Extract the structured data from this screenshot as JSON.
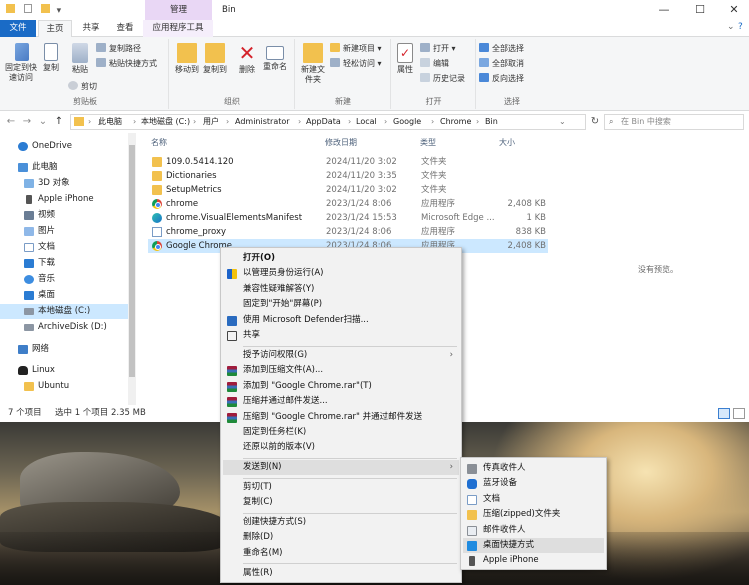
{
  "window": {
    "title": "Bin",
    "manage_tab": "管理",
    "controls": {
      "minimize": "—",
      "maximize": "☐",
      "close": "✕"
    }
  },
  "ribbon_tabs": [
    "文件",
    "主页",
    "共享",
    "查看",
    "应用程序工具"
  ],
  "ribbon": {
    "clipboard": {
      "label": "剪贴板",
      "pin": "固定到快速访问",
      "copy": "复制",
      "paste": "粘贴",
      "copy_path": "复制路径",
      "paste_shortcut": "粘贴快捷方式",
      "cut": "剪切"
    },
    "organize": {
      "label": "组织",
      "move_to": "移动到",
      "copy_to": "复制到",
      "delete": "删除",
      "rename": "重命名"
    },
    "new": {
      "label": "新建",
      "new_folder": "新建文件夹",
      "new_item": "新建项目 ▾",
      "easy_access": "轻松访问 ▾"
    },
    "open": {
      "label": "打开",
      "properties": "属性",
      "open": "打开 ▾",
      "edit": "编辑",
      "history": "历史记录"
    },
    "select": {
      "label": "选择",
      "select_all": "全部选择",
      "select_none": "全部取消",
      "invert": "反向选择"
    }
  },
  "address": {
    "crumbs": [
      "此电脑",
      "本地磁盘 (C:)",
      "用户",
      "Administrator",
      "AppData",
      "Local",
      "Google",
      "Chrome",
      "Bin"
    ],
    "search_placeholder": "在 Bin 中搜索"
  },
  "nav_pane": [
    {
      "label": "OneDrive",
      "icon": "cloud-icon"
    },
    {
      "label": "此电脑",
      "icon": "computer-icon"
    },
    {
      "label": "3D 对象",
      "icon": "3d-icon"
    },
    {
      "label": "Apple iPhone",
      "icon": "phone-icon"
    },
    {
      "label": "视频",
      "icon": "video-icon"
    },
    {
      "label": "图片",
      "icon": "picture-icon"
    },
    {
      "label": "文档",
      "icon": "document-icon"
    },
    {
      "label": "下载",
      "icon": "download-icon"
    },
    {
      "label": "音乐",
      "icon": "music-icon"
    },
    {
      "label": "桌面",
      "icon": "desktop-icon"
    },
    {
      "label": "本地磁盘 (C:)",
      "icon": "drive-icon"
    },
    {
      "label": "ArchiveDisk (D:)",
      "icon": "drive-icon"
    },
    {
      "label": "网络",
      "icon": "network-icon"
    },
    {
      "label": "Linux",
      "icon": "linux-icon"
    },
    {
      "label": "Ubuntu",
      "icon": "folder-icon"
    }
  ],
  "columns": {
    "name": "名称",
    "date": "修改日期",
    "type": "类型",
    "size": "大小"
  },
  "files": [
    {
      "name": "109.0.5414.120",
      "date": "2024/11/20 3:02",
      "type": "文件夹",
      "size": "",
      "icon": "folder-icon"
    },
    {
      "name": "Dictionaries",
      "date": "2024/11/20 3:35",
      "type": "文件夹",
      "size": "",
      "icon": "folder-icon"
    },
    {
      "name": "SetupMetrics",
      "date": "2024/11/20 3:02",
      "type": "文件夹",
      "size": "",
      "icon": "folder-icon"
    },
    {
      "name": "chrome",
      "date": "2023/1/24 8:06",
      "type": "应用程序",
      "size": "2,408 KB",
      "icon": "chrome-icon"
    },
    {
      "name": "chrome.VisualElementsManifest",
      "date": "2023/1/24 15:53",
      "type": "Microsoft Edge ...",
      "size": "1 KB",
      "icon": "edge-icon"
    },
    {
      "name": "chrome_proxy",
      "date": "2023/1/24 8:06",
      "type": "应用程序",
      "size": "838 KB",
      "icon": "document-icon"
    },
    {
      "name": "Google Chrome",
      "date": "2023/1/24 8:06",
      "type": "应用程序",
      "size": "2,408 KB",
      "icon": "chrome-icon"
    }
  ],
  "preview_text": "没有预览。",
  "status": {
    "count": "7 个项目",
    "selected": "选中 1 个项目  2.35 MB"
  },
  "context_menu": [
    {
      "label": "打开(O)",
      "bold": true
    },
    {
      "label": "以管理员身份运行(A)",
      "icon": "shield-icon"
    },
    {
      "label": "兼容性疑难解答(Y)"
    },
    {
      "label": "固定到\"开始\"屏幕(P)"
    },
    {
      "label": "使用 Microsoft Defender扫描...",
      "icon": "defender-icon"
    },
    {
      "label": "共享",
      "icon": "share-icon"
    },
    {
      "sep": true
    },
    {
      "label": "授予访问权限(G)",
      "arrow": true
    },
    {
      "label": "添加到压缩文件(A)...",
      "icon": "winrar-icon"
    },
    {
      "label": "添加到 \"Google Chrome.rar\"(T)",
      "icon": "winrar-icon"
    },
    {
      "label": "压缩并通过邮件发送...",
      "icon": "winrar-icon"
    },
    {
      "label": "压缩到 \"Google Chrome.rar\" 并通过邮件发送",
      "icon": "winrar-icon"
    },
    {
      "label": "固定到任务栏(K)"
    },
    {
      "label": "还原以前的版本(V)"
    },
    {
      "sep": true
    },
    {
      "label": "发送到(N)",
      "arrow": true,
      "highlight": true
    },
    {
      "sep": true
    },
    {
      "label": "剪切(T)"
    },
    {
      "label": "复制(C)"
    },
    {
      "sep": true
    },
    {
      "label": "创建快捷方式(S)"
    },
    {
      "label": "删除(D)"
    },
    {
      "label": "重命名(M)"
    },
    {
      "sep": true
    },
    {
      "label": "属性(R)"
    }
  ],
  "send_to_menu": [
    {
      "label": "传真收件人",
      "icon": "fax-icon"
    },
    {
      "label": "蓝牙设备",
      "icon": "bluetooth-icon"
    },
    {
      "label": "文档",
      "icon": "document-icon"
    },
    {
      "label": "压缩(zipped)文件夹",
      "icon": "zip-folder-icon"
    },
    {
      "label": "邮件收件人",
      "icon": "mail-icon"
    },
    {
      "label": "桌面快捷方式",
      "icon": "desktop-icon",
      "highlight": true
    },
    {
      "label": "Apple iPhone",
      "icon": "phone-icon"
    }
  ]
}
